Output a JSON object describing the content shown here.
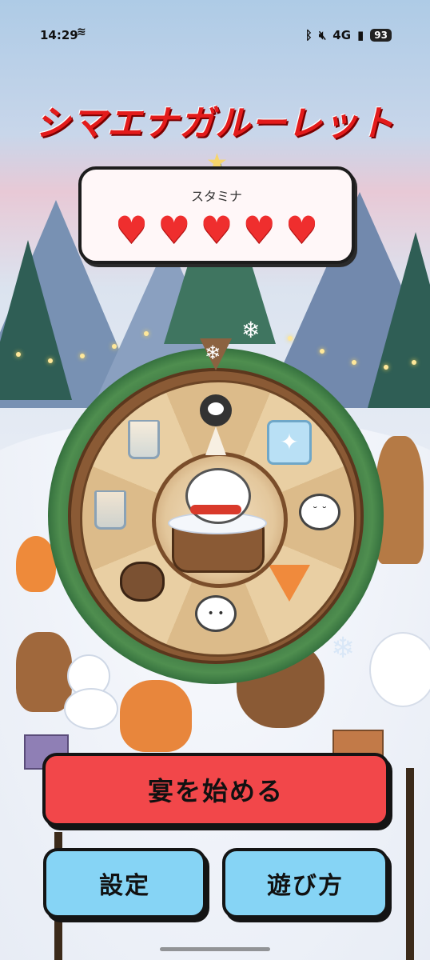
{
  "status_bar": {
    "time": "14:29",
    "network": "4G",
    "battery": "93"
  },
  "game": {
    "title": "シマエナガルーレット",
    "stamina": {
      "label": "スタミナ",
      "hearts": 5,
      "heart_symbol": "♥"
    },
    "wheel": {
      "segments": [
        "bomb",
        "ice-cube",
        "bird-sleeping",
        "fox",
        "bird-face",
        "bear",
        "empty-glass",
        "empty-glass"
      ],
      "pointer_icon": "snowflake-icon"
    }
  },
  "buttons": {
    "start": "宴を始める",
    "settings": "設定",
    "how_to_play": "遊び方"
  },
  "colors": {
    "title": "#e31b1b",
    "start_button": "#f2474a",
    "secondary_button": "#86d4f5",
    "heart": "#ef2e2e"
  }
}
